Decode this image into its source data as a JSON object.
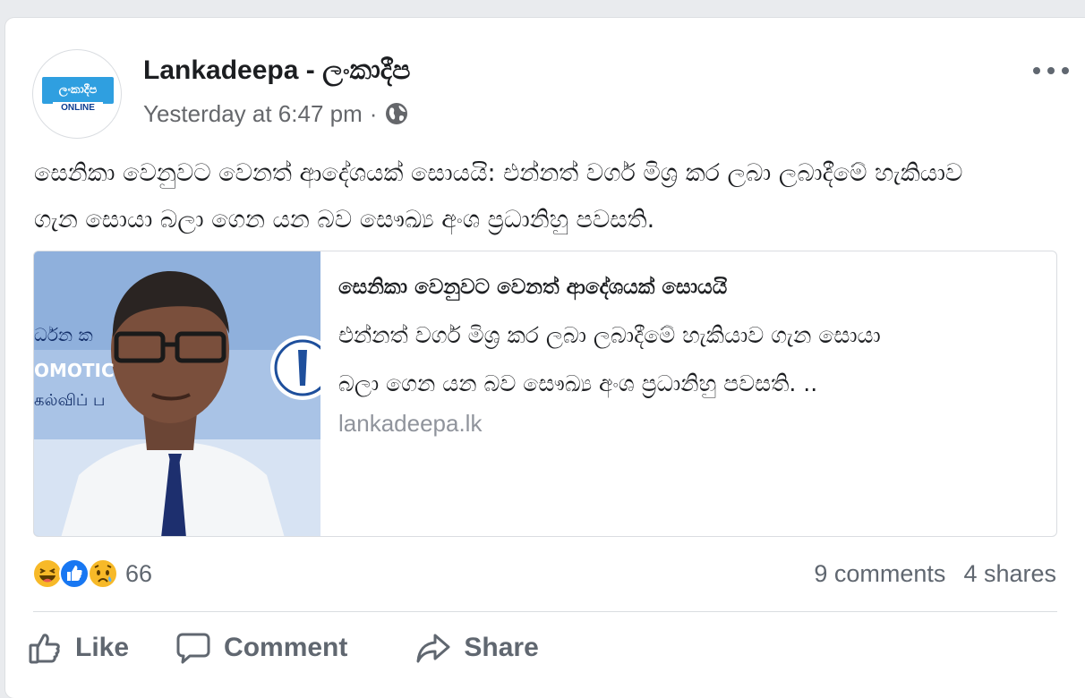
{
  "post": {
    "page_name": "Lankadeepa - ලංකාදීප",
    "timestamp": "Yesterday at 6:47 pm",
    "separator": "·",
    "avatar_logo": {
      "main": "ලංකාදීප",
      "sub": "ONLINE"
    },
    "text_line_1": "සෙනිකා වෙනුවට වෙනත් ආදේශයක් සොයයි: එන්නත් වර්ග මිශ්‍ර කර ලබා ලබාදීමේ හැකියාව",
    "text_line_2": "ගැන සොයා බලා ගෙන යන බව සෞඛ්‍ය අංශ ප්‍රධානිහු පවසති.",
    "link": {
      "title": "සෙනිකා වෙනුවට වෙනත් ආදේශයක් සොයයි",
      "desc_line_1": "එන්නත් වර්ග මිශ්‍ර කර ලබා ලබාදීමේ හැකියාව ගැන සොයා",
      "desc_line_2": "බලා ගෙන යන බව සෞඛ්‍ය අංශ ප්‍රධානිහු පවසති. ..",
      "domain": "lankadeepa.lk",
      "thumb_banner": [
        "ර්ධන ක",
        "OMOTIC",
        "கல்விப் ப"
      ]
    }
  },
  "engagement": {
    "reaction_count": "66",
    "reaction_icons": [
      "haha-icon",
      "like-icon",
      "sad-icon"
    ],
    "comments": "9 comments",
    "shares": "4 shares"
  },
  "actions": {
    "like": "Like",
    "comment": "Comment",
    "share": "Share"
  },
  "colors": {
    "background": "#e9ebee",
    "card": "#ffffff",
    "secondary_text": "#65676b",
    "like_blue": "#1877f2",
    "reaction_yellow": "#f7b928"
  }
}
